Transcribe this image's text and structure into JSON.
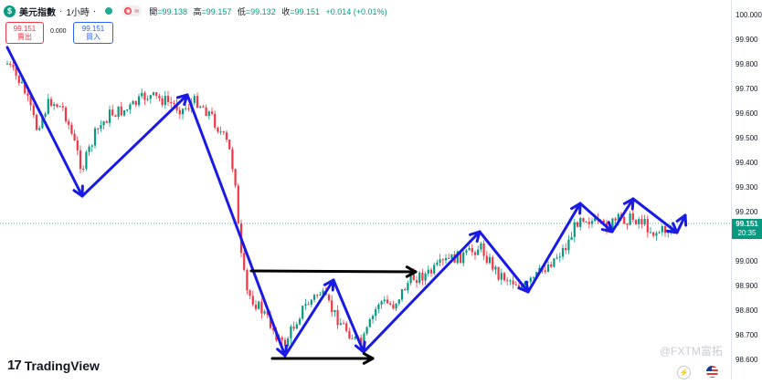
{
  "header": {
    "symbol_icon": "$",
    "symbol_name": "美元指數",
    "separator1": "·",
    "interval": "1小時",
    "separator2": "·",
    "status_dot_color": "#22ab94",
    "open_label": "開",
    "open_value": "=99.138",
    "high_label": "高",
    "high_value": "=99.157",
    "low_label": "低",
    "low_value": "=99.132",
    "close_label": "收",
    "close_value": "=99.151",
    "change_value": "+0.014 (+0.01%)"
  },
  "trade": {
    "sell_price": "99.151",
    "sell_label": "賣出",
    "spread": "0.000",
    "buy_price": "99.151",
    "buy_label": "買入"
  },
  "price_axis": {
    "ticks": [
      "100.000",
      "99.900",
      "99.800",
      "99.700",
      "99.600",
      "99.500",
      "99.400",
      "99.300",
      "99.200",
      "99.000",
      "98.900",
      "98.800",
      "98.700",
      "98.600"
    ],
    "current_price": "99.151",
    "countdown": "20:35"
  },
  "branding": {
    "logo_mark": "17",
    "logo_text": "TradingView",
    "watermark": "@FXTM富拓"
  },
  "colors": {
    "up": "#089981",
    "down": "#f23645",
    "trend_arrows": "#1a1ae6",
    "range_arrows": "#000000"
  }
}
